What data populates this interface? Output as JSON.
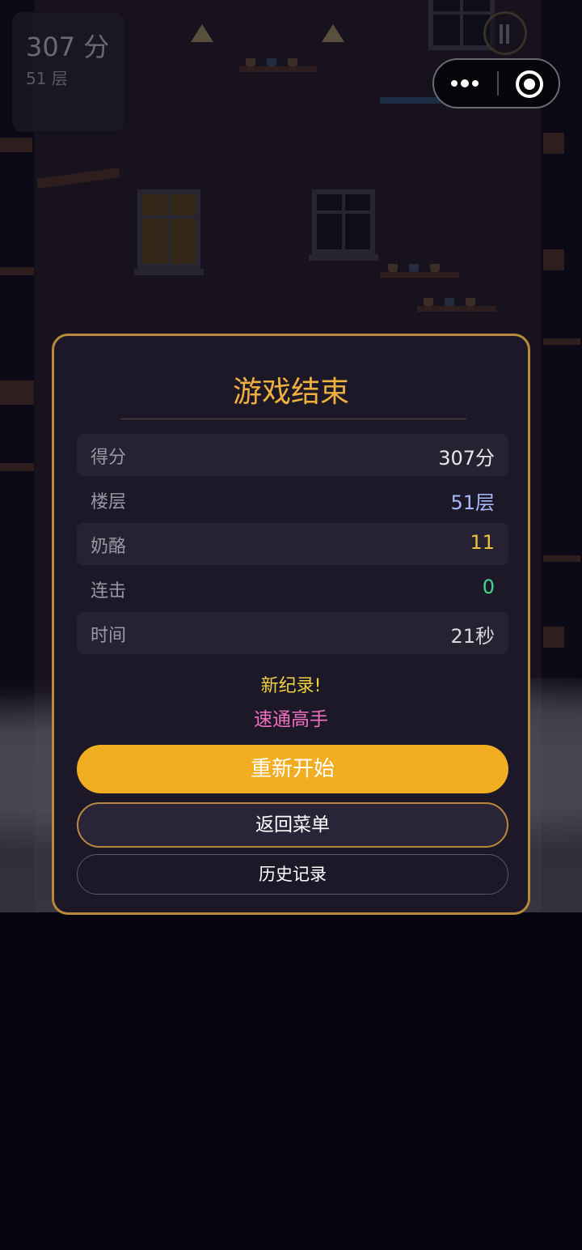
{
  "hud": {
    "score": "307 分",
    "floor": "51 层"
  },
  "modal": {
    "title": "游戏结束",
    "stats": [
      {
        "label": "得分",
        "value": "307分",
        "color": "#e8e6ee"
      },
      {
        "label": "楼层",
        "value": "51层",
        "color": "#a8b8f8"
      },
      {
        "label": "奶酪",
        "value": "11",
        "color": "#f0c040"
      },
      {
        "label": "连击",
        "value": "0",
        "color": "#40d890"
      },
      {
        "label": "时间",
        "value": "21秒",
        "color": "#d8d6de"
      }
    ],
    "new_record": "新纪录!",
    "achievement": "速通高手",
    "buttons": {
      "restart": "重新开始",
      "menu": "返回菜单",
      "history": "历史记录"
    }
  },
  "colors": {
    "accent": "#f2ae22",
    "modal_border": "#b8893a",
    "modal_bg": "#1c1828",
    "title": "#f0b040",
    "new_record": "#f0d040",
    "achievement": "#f070c0"
  },
  "icons": {
    "pause": "pause-icon",
    "more": "more-dots-icon",
    "close": "close-target-icon",
    "cheese": "cheese-icon"
  }
}
